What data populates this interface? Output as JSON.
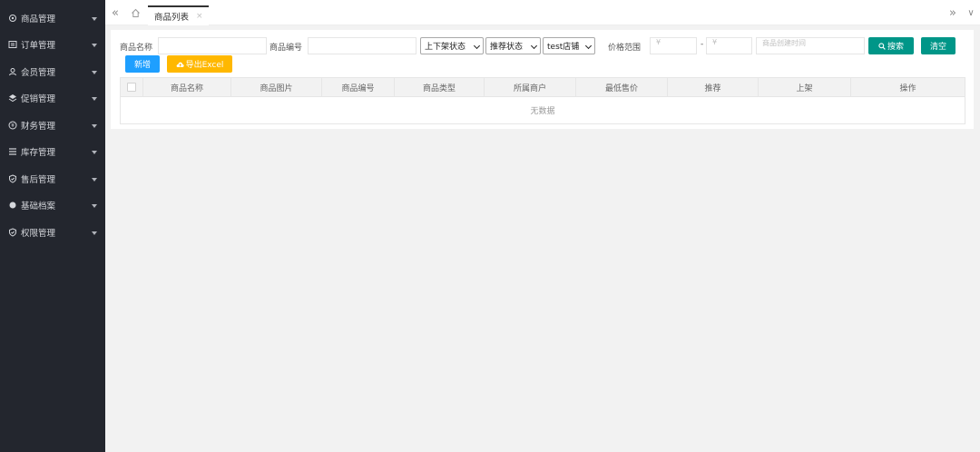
{
  "sidebar": {
    "items": [
      {
        "label": "商品管理",
        "icon": "gear-icon"
      },
      {
        "label": "订单管理",
        "icon": "list-icon"
      },
      {
        "label": "会员管理",
        "icon": "user-icon"
      },
      {
        "label": "促销管理",
        "icon": "layers-icon"
      },
      {
        "label": "财务管理",
        "icon": "money-icon"
      },
      {
        "label": "库存管理",
        "icon": "stack-icon"
      },
      {
        "label": "售后管理",
        "icon": "shield-icon"
      },
      {
        "label": "基础档案",
        "icon": "dot-icon"
      },
      {
        "label": "权限管理",
        "icon": "shield-check-icon"
      }
    ]
  },
  "tabs": {
    "prev_glyph": "«",
    "home_glyph": "⌂",
    "active_label": "商品列表",
    "close_glyph": "×",
    "next_glyph": "»",
    "more_glyph": "∨"
  },
  "filters": {
    "name_label": "商品名称",
    "name_value": "",
    "code_label": "商品编号",
    "code_value": "",
    "shelf_status": "上下架状态",
    "recommend_status": "推荐状态",
    "store": "test店铺",
    "price_range_label": "价格范围",
    "price_min_placeholder": "¥",
    "price_max_placeholder": "¥",
    "range_dash": "-",
    "created_time_placeholder": "商品创建时间",
    "search_label": "搜索",
    "clear_label": "清空"
  },
  "actions": {
    "add_label": "新增",
    "export_label": "导出Excel"
  },
  "table": {
    "columns": [
      "商品名称",
      "商品图片",
      "商品编号",
      "商品类型",
      "所属商户",
      "最低售价",
      "推荐",
      "上架",
      "操作"
    ],
    "empty_text": "无数据"
  },
  "colors": {
    "sidebar_bg": "#23262e",
    "primary": "#009688",
    "blue": "#1e9fff",
    "warning": "#ffb800"
  }
}
